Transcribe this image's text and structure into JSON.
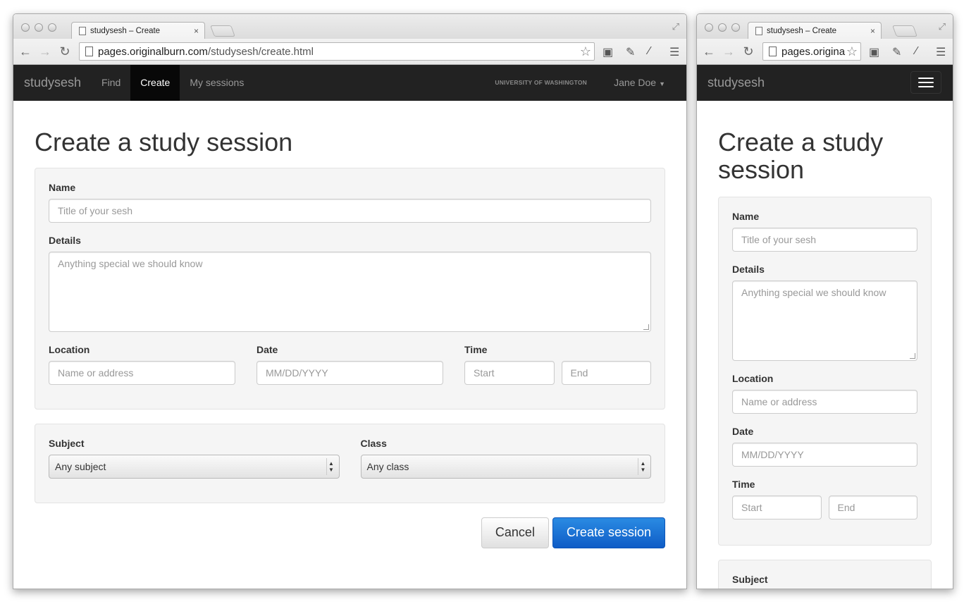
{
  "browser": {
    "tab_title": "studysesh – Create",
    "tab_close": "×",
    "url_host": "pages.originalburn.com",
    "url_path": "/studysesh/create.html",
    "url_host_truncated": "pages.origina"
  },
  "navbar": {
    "brand": "studysesh",
    "links": [
      "Find",
      "Create",
      "My sessions"
    ],
    "active": "Create",
    "university": "UNIVERSITY OF WASHINGTON",
    "user": "Jane Doe"
  },
  "page": {
    "title": "Create a study session",
    "title_line1": "Create a study",
    "title_line2": "session"
  },
  "form": {
    "name_label": "Name",
    "name_placeholder": "Title of your sesh",
    "details_label": "Details",
    "details_placeholder": "Anything special we should know",
    "location_label": "Location",
    "location_placeholder": "Name or address",
    "date_label": "Date",
    "date_placeholder": "MM/DD/YYYY",
    "time_label": "Time",
    "time_start_placeholder": "Start",
    "time_end_placeholder": "End",
    "subject_label": "Subject",
    "subject_value": "Any subject",
    "class_label": "Class",
    "class_value": "Any class"
  },
  "actions": {
    "cancel": "Cancel",
    "submit": "Create session"
  },
  "colors": {
    "navbar_bg": "#222222",
    "active_nav_bg": "#080808",
    "primary": "#1466d4",
    "well_bg": "#f5f5f5"
  }
}
